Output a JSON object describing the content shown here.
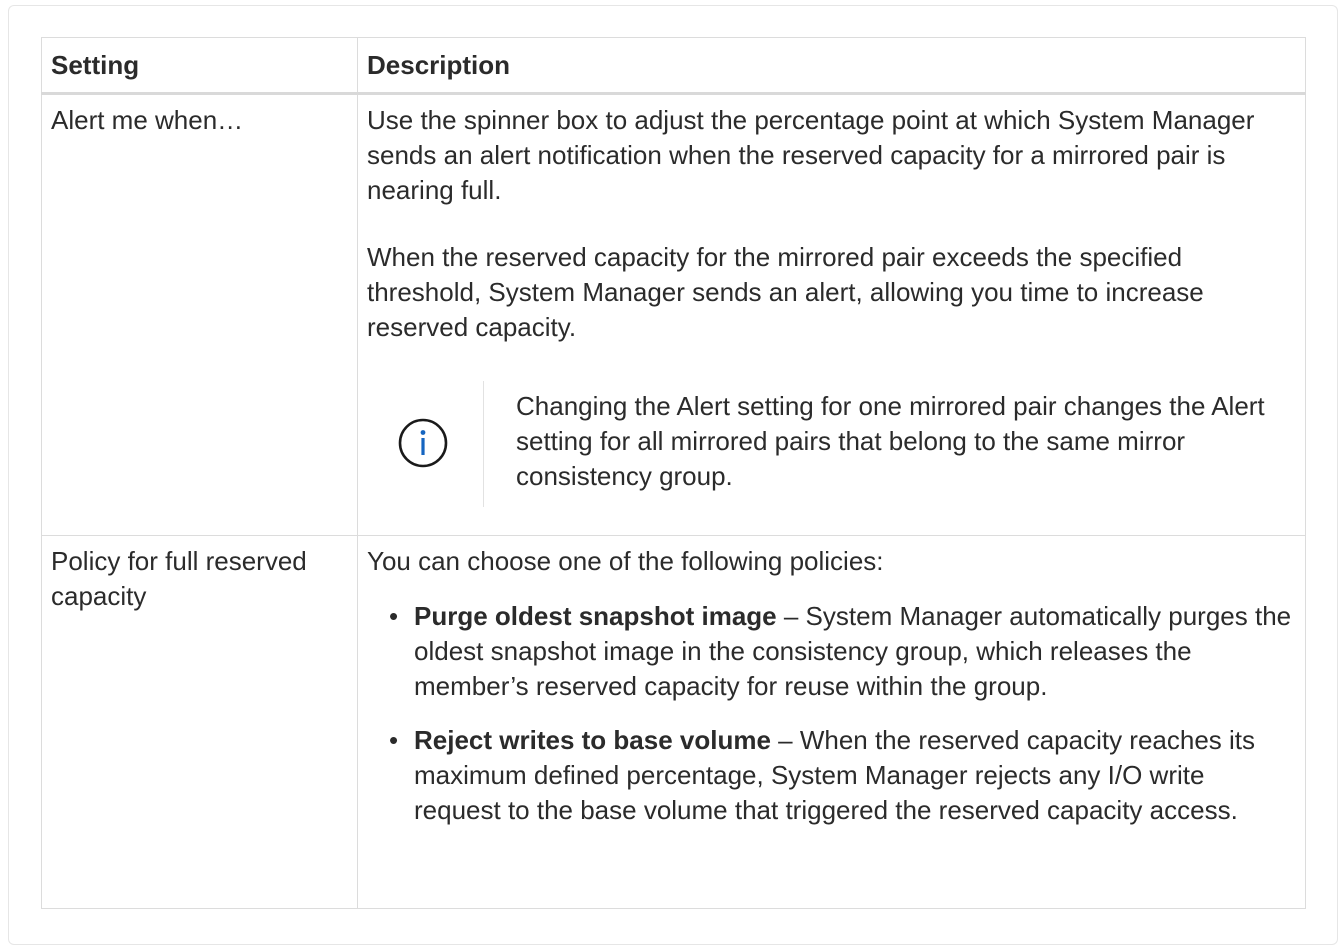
{
  "table": {
    "headers": {
      "setting": "Setting",
      "description": "Description"
    },
    "rows": [
      {
        "setting": "Alert me when…",
        "paragraphs": [
          "Use the spinner box to adjust the percentage point at which System Manager sends an alert notification when the reserved capacity for a mirrored pair is nearing full.",
          "When the reserved capacity for the mirrored pair exceeds the specified threshold, System Manager sends an alert, allowing you time to increase reserved capacity."
        ],
        "note": {
          "icon": "info-icon",
          "text": "Changing the Alert setting for one mirrored pair changes the Alert setting for all mirrored pairs that belong to the same mirror consistency group."
        }
      },
      {
        "setting": "Policy for full reserved capacity",
        "intro": "You can choose one of the following policies:",
        "items": [
          {
            "bullet": "•",
            "term": "Purge oldest snapshot image",
            "detail": " – System Manager automatically purges the oldest snapshot image in the consistency group, which releases the member’s reserved capacity for reuse within the group."
          },
          {
            "bullet": "•",
            "term": "Reject writes to base volume",
            "detail": " – When the reserved capacity reaches its maximum defined percentage, System Manager rejects any I/O write request to the base volume that triggered the reserved capacity access."
          }
        ]
      }
    ]
  },
  "colors": {
    "text": "#2b2b2b",
    "border": "#dcdcdc",
    "info_icon": "#1565c0"
  }
}
